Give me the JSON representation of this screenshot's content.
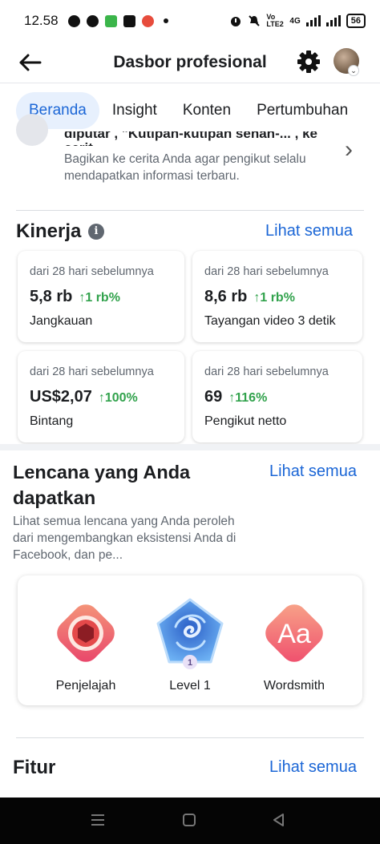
{
  "status_bar": {
    "time": "12.58",
    "network_label": "Vo LTE2",
    "network_type": "4G",
    "battery": "56"
  },
  "header": {
    "title": "Dasbor profesional",
    "back_icon": "back-arrow-icon",
    "settings_icon": "gear-icon"
  },
  "tabs": [
    {
      "label": "Beranda",
      "active": true
    },
    {
      "label": "Insight",
      "active": false
    },
    {
      "label": "Konten",
      "active": false
    },
    {
      "label": "Pertumbuhan",
      "active": false
    }
  ],
  "story_prompt": {
    "clipped_title": "diputar , \"Kutipan-kutipan senan-... , ke cerit...",
    "description": "Bagikan ke cerita Anda agar pengikut selalu mendapatkan informasi terbaru."
  },
  "performance": {
    "title": "Kinerja",
    "see_all": "Lihat semua",
    "cards": [
      {
        "period": "dari 28 hari sebelumnya",
        "value": "5,8 rb",
        "change": "↑1 rb%",
        "label": "Jangkauan"
      },
      {
        "period": "dari 28 hari sebelumnya",
        "value": "8,6 rb",
        "change": "↑1 rb%",
        "label": "Tayangan video 3 detik"
      },
      {
        "period": "dari 28 hari sebelumnya",
        "value": "US$2,07",
        "change": "↑100%",
        "label": "Bintang"
      },
      {
        "period": "dari 28 hari sebelumnya",
        "value": "69",
        "change": "↑116%",
        "label": "Pengikut netto"
      }
    ]
  },
  "badges": {
    "title": "Lencana yang Anda dapatkan",
    "see_all": "Lihat semua",
    "description": "Lihat semua lencana yang Anda peroleh dari mengembangkan eksistensi Anda di Facebook, dan pe...",
    "items": [
      {
        "label": "Penjelajah",
        "icon": "explorer-badge-icon"
      },
      {
        "label": "Level 1",
        "icon": "level-badge-icon",
        "level": "1"
      },
      {
        "label": "Wordsmith",
        "icon": "wordsmith-badge-icon",
        "glyph": "Aa"
      }
    ]
  },
  "features": {
    "title": "Fitur",
    "see_all": "Lihat semua"
  },
  "colors": {
    "accent": "#1b66d6",
    "positive": "#31a24c",
    "tab_active_bg": "#e7f0fd"
  }
}
